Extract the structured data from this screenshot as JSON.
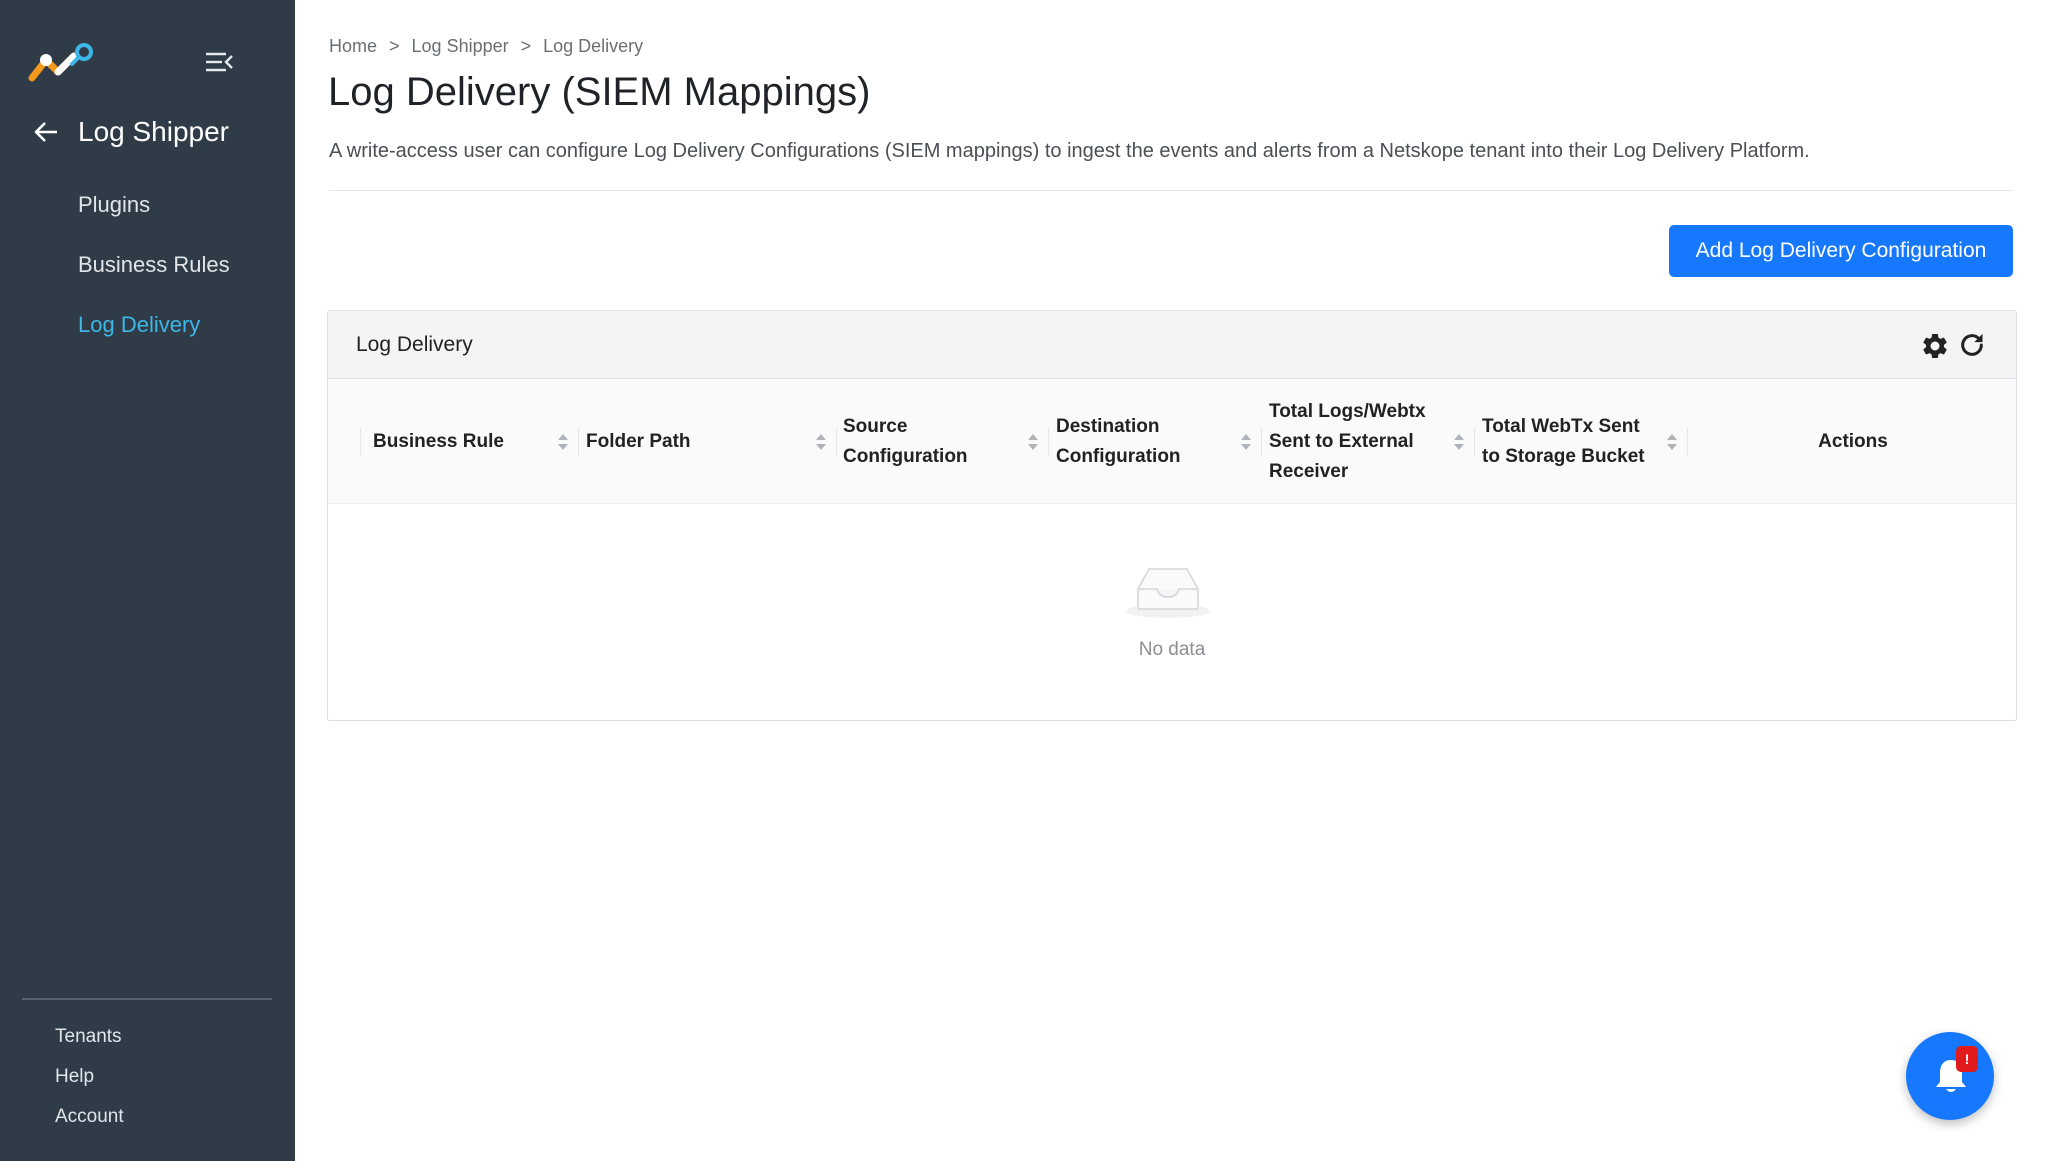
{
  "sidebar": {
    "back_title": "Log Shipper",
    "items": [
      {
        "label": "Plugins"
      },
      {
        "label": "Business Rules"
      },
      {
        "label": "Log Delivery"
      }
    ],
    "active_index": 2,
    "bottom_items": [
      {
        "label": "Tenants"
      },
      {
        "label": "Help"
      },
      {
        "label": "Account"
      }
    ]
  },
  "breadcrumb": {
    "items": [
      "Home",
      "Log Shipper",
      "Log Delivery"
    ],
    "separator": ">"
  },
  "page": {
    "title": "Log Delivery (SIEM Mappings)",
    "description": "A write-access user can configure Log Delivery Configurations (SIEM mappings) to ingest the events and alerts from a Netskope tenant into their Log Delivery Platform.",
    "add_button_label": "Add Log Delivery Configuration"
  },
  "table": {
    "title": "Log Delivery",
    "columns": [
      {
        "label": "Business Rule"
      },
      {
        "label": "Folder Path"
      },
      {
        "label": "Source\nConfiguration"
      },
      {
        "label": "Destination\nConfiguration"
      },
      {
        "label": "Total Logs/Webtx\nSent to External\nReceiver"
      },
      {
        "label": "Total WebTx Sent\nto Storage Bucket"
      },
      {
        "label": "Actions"
      }
    ],
    "empty_text": "No data"
  },
  "notifications": {
    "badge": "!"
  },
  "colors": {
    "sidebar_bg": "#2f3c48",
    "accent": "#1677ff",
    "active_nav": "#3eb6e6",
    "badge": "#e11b1b"
  },
  "icons": [
    "netskope-logo",
    "menu-collapse-icon",
    "back-arrow-icon",
    "gear-icon",
    "refresh-icon",
    "sort-icon",
    "empty-inbox-icon",
    "bell-icon"
  ]
}
